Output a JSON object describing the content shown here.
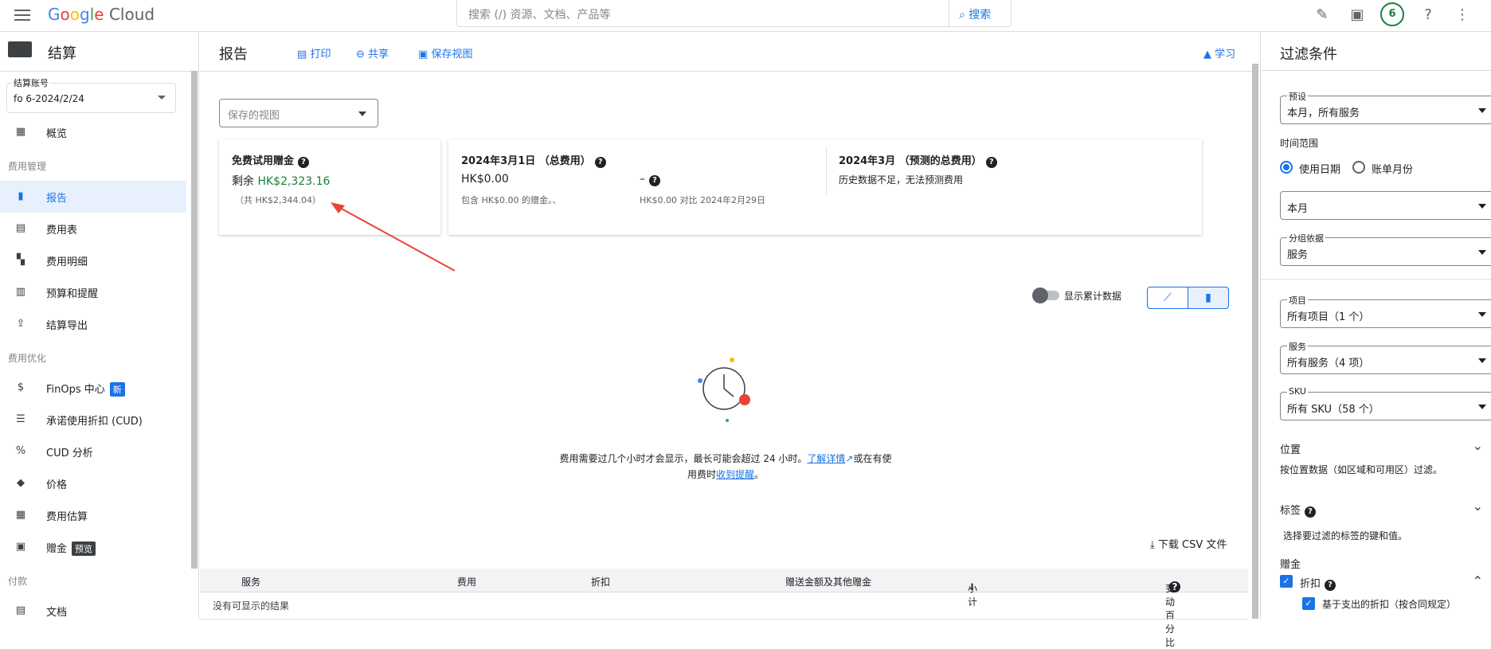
{
  "topbar": {
    "logo": "Google Cloud",
    "search_placeholder": "搜索 (/) 资源、文档、产品等",
    "search_button": "搜索",
    "notification_count": "6"
  },
  "sidebar": {
    "title": "结算",
    "account_label": "结算账号",
    "account_value": "fo          6-2024/2/24",
    "sections": {
      "cost_management": "费用管理",
      "cost_optimization": "费用优化",
      "payment": "付款"
    },
    "items": [
      {
        "label": "概览",
        "icon": "overview-icon"
      },
      {
        "label": "报告",
        "icon": "bar-chart-icon"
      },
      {
        "label": "费用表",
        "icon": "table-icon"
      },
      {
        "label": "费用明细",
        "icon": "waterfall-icon"
      },
      {
        "label": "预算和提醒",
        "icon": "budget-icon"
      },
      {
        "label": "结算导出",
        "icon": "upload-icon"
      },
      {
        "label": "FinOps 中心",
        "tag": "新",
        "icon": "dollar-icon"
      },
      {
        "label": "承诺使用折扣 (CUD)",
        "icon": "list-icon"
      },
      {
        "label": "CUD 分析",
        "icon": "percent-icon"
      },
      {
        "label": "价格",
        "icon": "price-tag-icon"
      },
      {
        "label": "费用估算",
        "icon": "calculator-icon"
      },
      {
        "label": "赠金",
        "tag": "预览",
        "icon": "gift-icon"
      },
      {
        "label": "文档",
        "icon": "document-icon"
      }
    ]
  },
  "main": {
    "title": "报告",
    "print": "打印",
    "share": "共享",
    "save_view": "保存视图",
    "learn": "学习",
    "saved_view_placeholder": "保存的视图",
    "trial_card": {
      "title": "免费试用赠金",
      "remaining_label": "剩余",
      "remaining_value": "HK$2,323.16",
      "total": "（共 HK$2,344.04）"
    },
    "cost_card": {
      "title": "2024年3月1日 （总费用）",
      "amount": "HK$0.00",
      "note": "包含 HK$0.00 的赠金。、",
      "dash": "–",
      "compare": "HK$0.00 对比 2024年2月29日",
      "forecast_title": "2024年3月 （预测的总费用）",
      "forecast_note": "历史数据不足，无法预测费用"
    },
    "cumulative_label": "显示累计数据",
    "empty_message_1": "费用需要过几个小时才会显示，最长可能会超过 24 小时。",
    "learn_more": "了解详情",
    "empty_message_2": "或在有使",
    "empty_message_3": "用费时",
    "get_alerts": "收到提醒",
    "period": "。",
    "download_csv": "下载 CSV 文件",
    "table_headers": [
      "服务",
      "费用",
      "折扣",
      "赠送金额及其他赠金",
      "小计",
      "变动百分比"
    ],
    "no_results": "没有可显示的结果"
  },
  "filters": {
    "title": "过滤条件",
    "preset_label": "预设",
    "preset_value": "本月，所有服务",
    "time_range_label": "时间范围",
    "use_date": "使用日期",
    "invoice_month": "账单月份",
    "period_value": "本月",
    "group_by_label": "分组依据",
    "group_by_value": "服务",
    "projects_label": "项目",
    "projects_value": "所有项目（1 个）",
    "services_label": "服务",
    "services_value": "所有服务（4 项）",
    "sku_label": "SKU",
    "sku_value": "所有 SKU（58 个）",
    "location_label": "位置",
    "location_desc": "按位置数据（如区域和可用区）过滤。",
    "labels_label": "标签",
    "labels_desc": "选择要过滤的标签的键和值。",
    "credits_label": "赠金",
    "discount_label": "折扣",
    "spend_discount_label": "基于支出的折扣（按合同规定）"
  },
  "colors": {
    "accent": "#1a73e8",
    "credit_green": "#188038",
    "arrow_red": "#ea4335"
  }
}
